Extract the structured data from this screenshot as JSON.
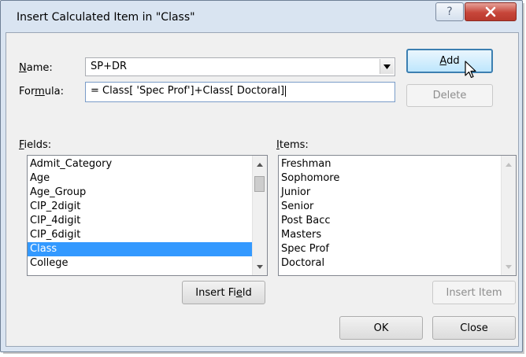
{
  "dialog": {
    "title": "Insert Calculated Item in \"Class\"",
    "help_label": "?"
  },
  "name": {
    "label_ul": "N",
    "label_rest": "ame:",
    "value": "SP+DR"
  },
  "formula": {
    "label_pre": "For",
    "label_ul": "m",
    "label_post": "ula:",
    "value": "= Class[ 'Spec Prof']+Class[ Doctoral]"
  },
  "buttons": {
    "add_ul": "A",
    "add_rest": "dd",
    "delete": "Delete",
    "insert_field_pre": "Insert Fi",
    "insert_field_ul": "e",
    "insert_field_post": "ld",
    "insert_item": "Insert Item",
    "ok": "OK",
    "close": "Close"
  },
  "fields": {
    "label_ul": "F",
    "label_rest": "ields:",
    "items": [
      "Admit_Category",
      "Age",
      "Age_Group",
      "CIP_2digit",
      "CIP_4digit",
      "CIP_6digit",
      "Class",
      "College"
    ],
    "selected": "Class"
  },
  "items": {
    "label_ul": "I",
    "label_rest": "tems:",
    "items": [
      "Freshman",
      "Sophomore",
      "Junior",
      "Senior",
      "Post Bacc",
      "Masters",
      "Spec Prof",
      "Doctoral"
    ]
  },
  "colors": {
    "selection": "#3399ff",
    "close_button": "#c7463a",
    "default_button_border": "#3c7fb1"
  }
}
